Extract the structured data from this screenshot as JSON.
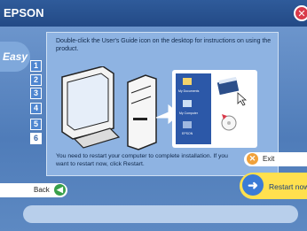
{
  "window": {
    "title": "EPSON",
    "close_label": "✕"
  },
  "sidebar": {
    "mode_label": "Easy",
    "steps": [
      "1",
      "2",
      "3",
      "4",
      "5",
      "6"
    ],
    "active_step": "6"
  },
  "panel": {
    "instruction": "Double-click the User's Guide icon on the desktop for instructions on using the product.",
    "restart_note": "You need to restart your computer to complete installation. If you want to restart now, click Restart.",
    "desktop_icons": [
      "My Documents",
      "My Computer",
      "EPSON"
    ]
  },
  "actions": {
    "exit_label": "Exit",
    "restart_label": "Restart now",
    "back_label": "Back"
  },
  "colors": {
    "accent": "#3b7bd6",
    "restart": "#ffe04e",
    "exit": "#f0a13b",
    "back": "#38a04a",
    "close": "#d93a4a"
  }
}
